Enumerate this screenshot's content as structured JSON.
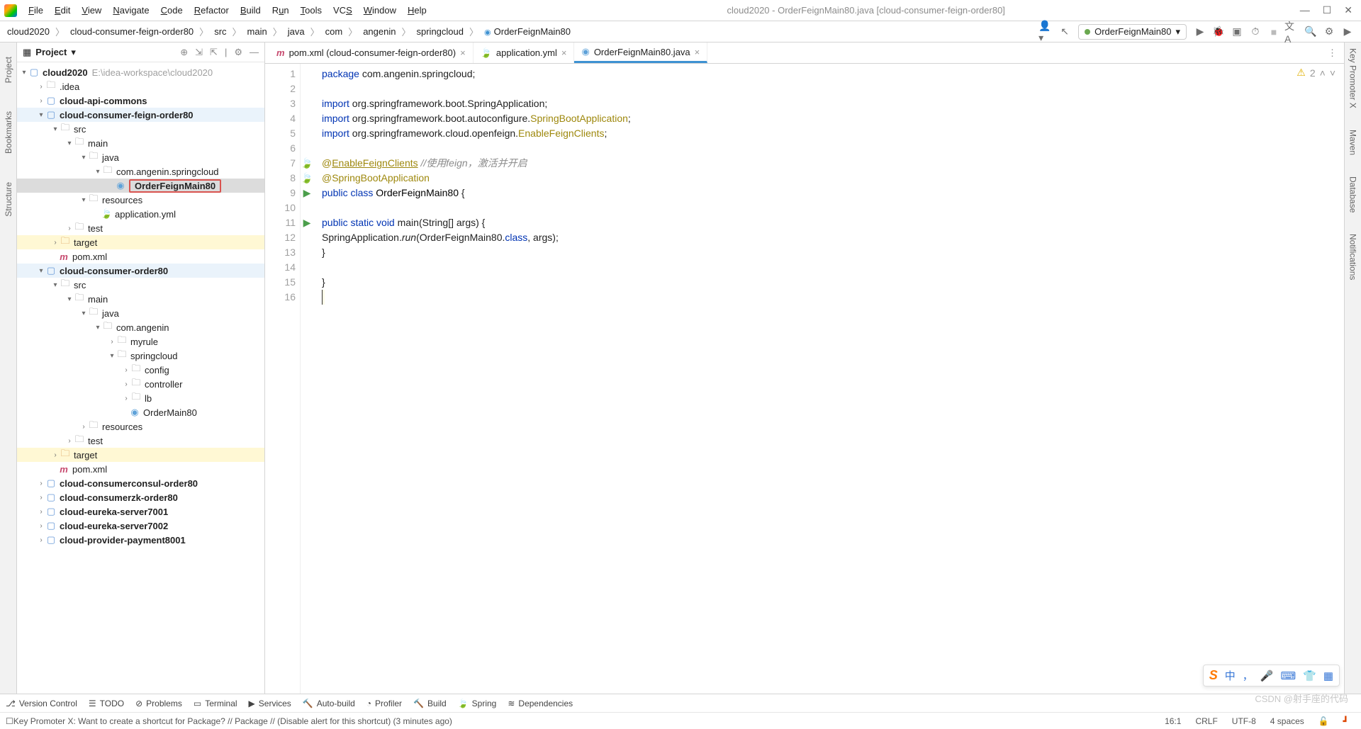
{
  "menu": {
    "items": [
      "File",
      "Edit",
      "View",
      "Navigate",
      "Code",
      "Refactor",
      "Build",
      "Run",
      "Tools",
      "VCS",
      "Window",
      "Help"
    ]
  },
  "window_title": "cloud2020 - OrderFeignMain80.java [cloud-consumer-feign-order80]",
  "breadcrumbs": [
    "cloud2020",
    "cloud-consumer-feign-order80",
    "src",
    "main",
    "java",
    "com",
    "angenin",
    "springcloud",
    "OrderFeignMain80"
  ],
  "run_config": "OrderFeignMain80",
  "sidebar": {
    "title": "Project",
    "root": "cloud2020",
    "root_hint": "E:\\idea-workspace\\cloud2020",
    "idea": ".idea",
    "cloud_api_commons": "cloud-api-commons",
    "cloud_consumer_feign": "cloud-consumer-feign-order80",
    "src": "src",
    "main": "main",
    "java": "java",
    "pkg1": "com.angenin.springcloud",
    "orderfeign": "OrderFeignMain80",
    "resources": "resources",
    "app_yml": "application.yml",
    "test": "test",
    "target": "target",
    "pom": "pom.xml",
    "cloud_consumer_order": "cloud-consumer-order80",
    "com_angenin": "com.angenin",
    "myrule": "myrule",
    "springcloud": "springcloud",
    "config": "config",
    "controller": "controller",
    "lb": "lb",
    "ordermain": "OrderMain80",
    "cloud_consul": "cloud-consumerconsul-order80",
    "cloud_zk": "cloud-consumerzk-order80",
    "eureka7001": "cloud-eureka-server7001",
    "eureka7002": "cloud-eureka-server7002",
    "payment8001": "cloud-provider-payment8001"
  },
  "tabs": [
    {
      "icon": "m",
      "label": "pom.xml (cloud-consumer-feign-order80)",
      "active": false
    },
    {
      "icon": "yml",
      "label": "application.yml",
      "active": false
    },
    {
      "icon": "java",
      "label": "OrderFeignMain80.java",
      "active": true
    }
  ],
  "editor": {
    "warnings": "2",
    "lines": {
      "l1a": "package",
      "l1b": " com.angenin.springcloud;",
      "l3a": "import",
      "l3b": " org.springframework.boot.SpringApplication;",
      "l4a": "import",
      "l4b": " org.springframework.boot.autoconfigure.",
      "l4c": "SpringBootApplication",
      "l4d": ";",
      "l5a": "import",
      "l5b": " org.springframework.cloud.openfeign.",
      "l5c": "EnableFeignClients",
      "l5d": ";",
      "l7a": "@",
      "l7b": "EnableFeignClients",
      "l7c": " //使用feign，激活并开启",
      "l8a": "@SpringBootApplication",
      "l9a": "public class ",
      "l9b": "OrderFeignMain80",
      "l9c": " {",
      "l11a": "    public static void ",
      "l11b": "main",
      "l11c": "(String[] args) {",
      "l12a": "        SpringApplication.",
      "l12b": "run",
      "l12c": "(OrderFeignMain80.",
      "l12d": "class",
      "l12e": ", args);",
      "l13": "    }",
      "l15": "}"
    }
  },
  "toolwindows": [
    "Version Control",
    "TODO",
    "Problems",
    "Terminal",
    "Services",
    "Auto-build",
    "Profiler",
    "Build",
    "Spring",
    "Dependencies"
  ],
  "status": {
    "msg": "Key Promoter X: Want to create a shortcut for Package? // Package // (Disable alert for this shortcut) (3 minutes ago)",
    "pos": "16:1",
    "eol": "CRLF",
    "enc": "UTF-8",
    "indent": "4 spaces"
  },
  "ime": {
    "label": "中"
  },
  "watermark": "CSDN @射手座的代码"
}
